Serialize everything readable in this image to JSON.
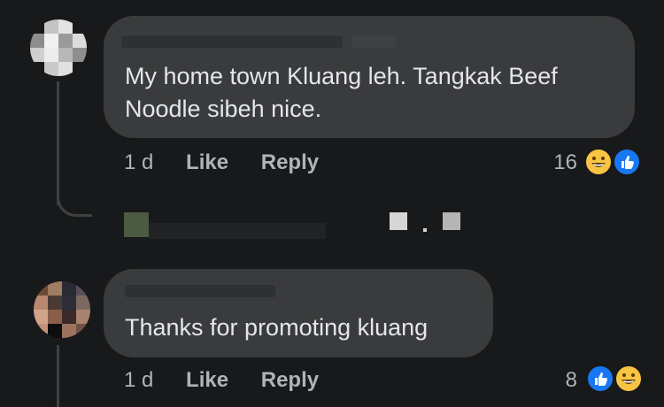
{
  "comments": [
    {
      "author_blurred": true,
      "text": "My home town Kluang leh. Tangkak Beef Noodle sibeh nice.",
      "time": "1 d",
      "like_label": "Like",
      "reply_label": "Reply",
      "reaction_count": "16",
      "reactions": [
        "haha-icon",
        "like-icon"
      ]
    },
    {
      "author_blurred": true,
      "text": "Thanks for promoting kluang",
      "time": "1 d",
      "like_label": "Like",
      "reply_label": "Reply",
      "reaction_count": "8",
      "reactions": [
        "like-icon",
        "haha-icon"
      ]
    }
  ],
  "colors": {
    "background": "#18191a",
    "bubble": "#3a3b3c",
    "text": "#e4e6eb",
    "meta": "#b0b3b8",
    "like_blue": "#1877f2",
    "haha_yellow": "#f7c444"
  }
}
